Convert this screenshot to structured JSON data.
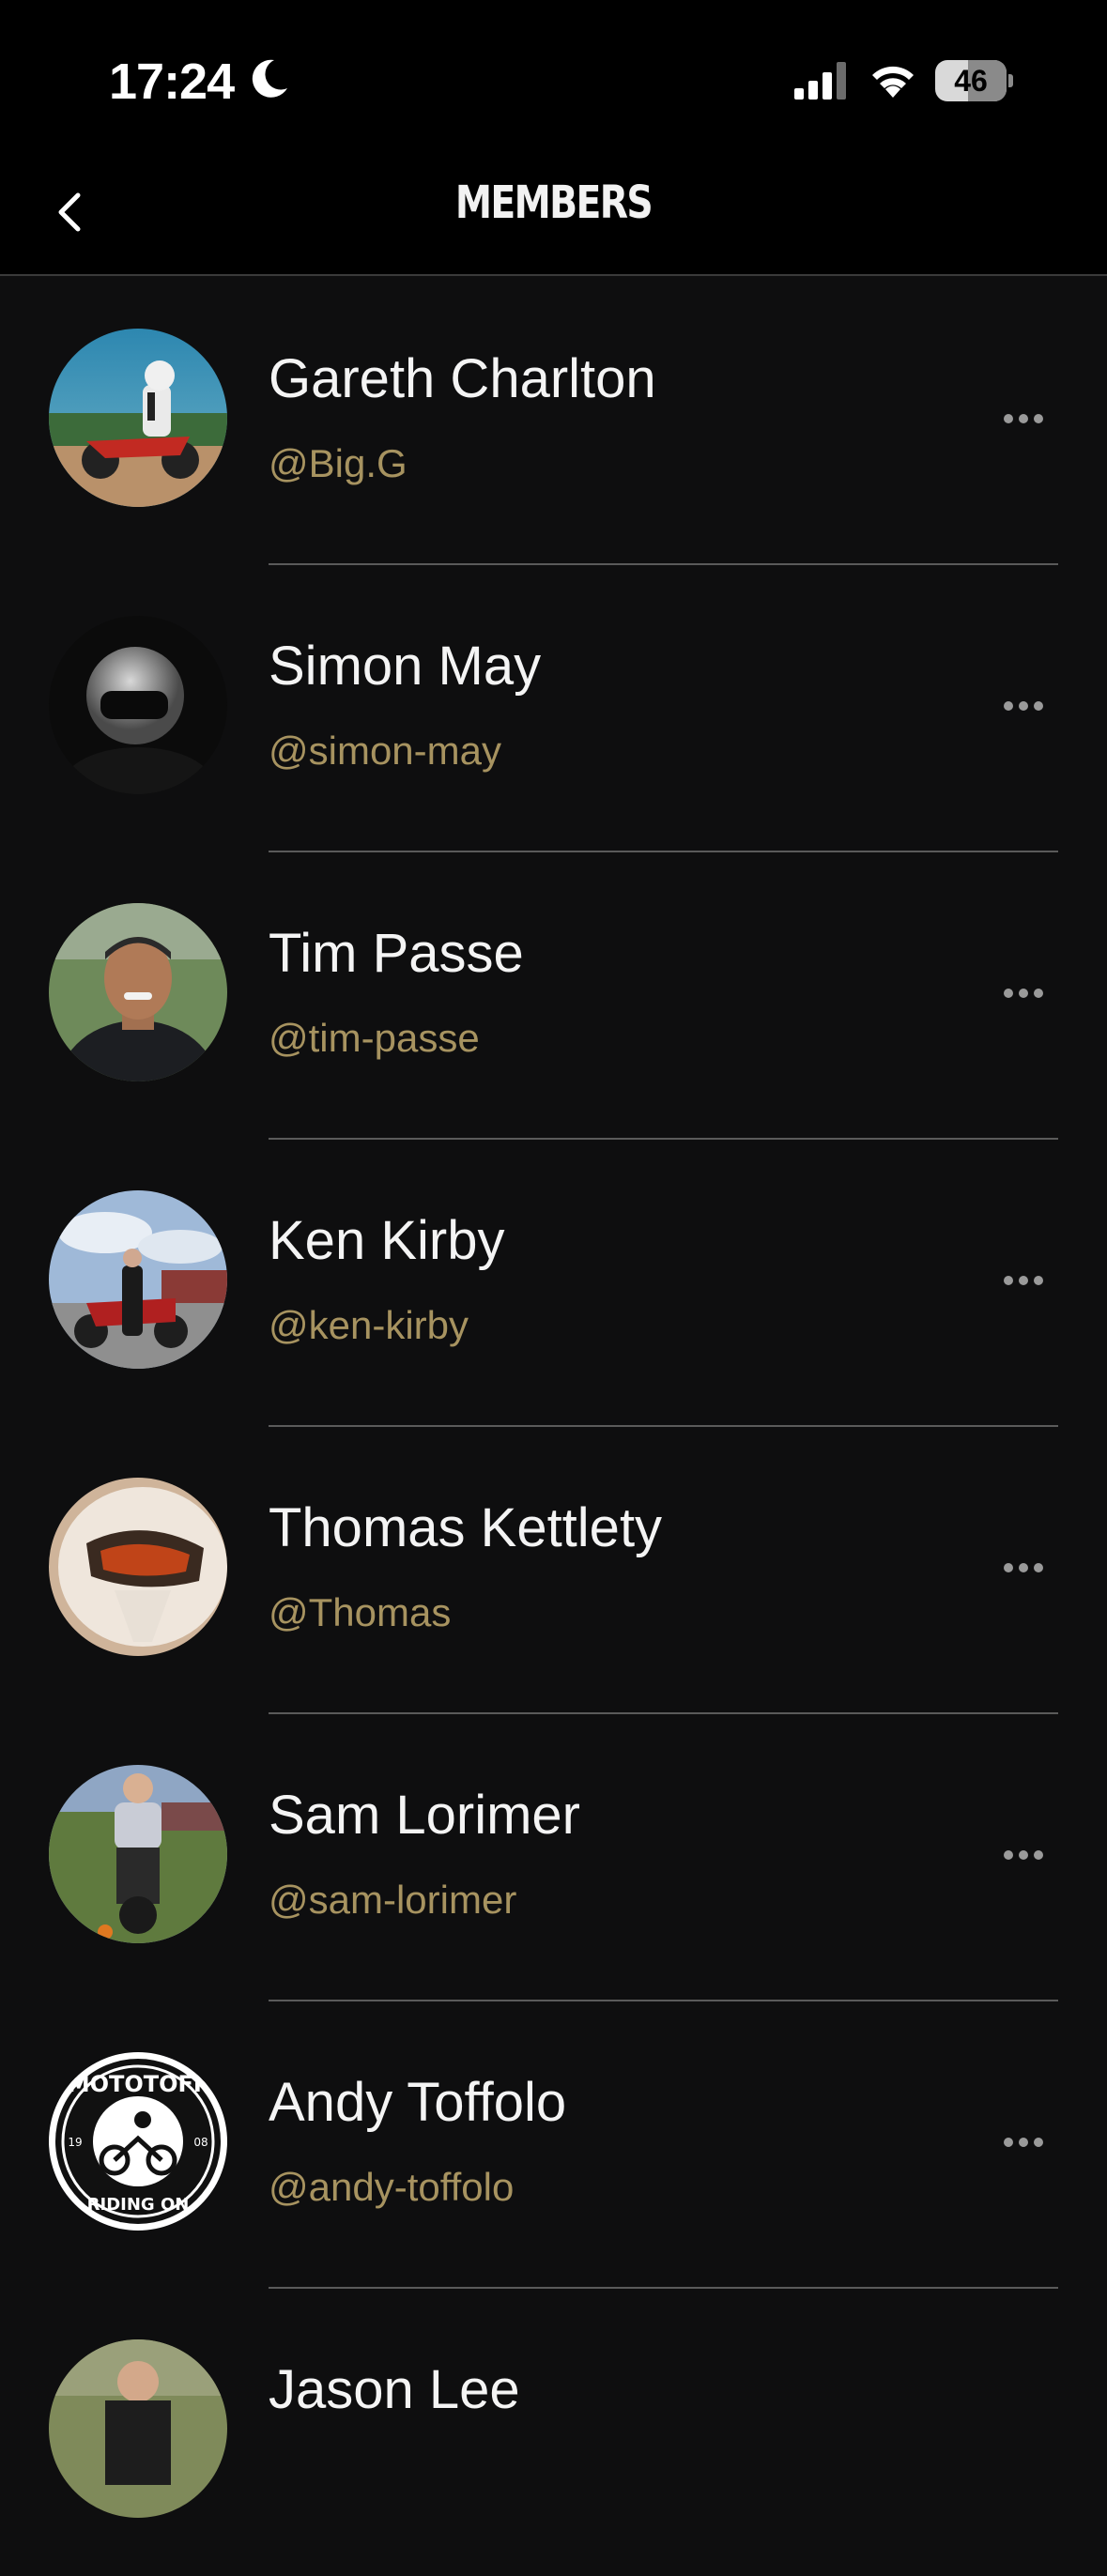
{
  "status_bar": {
    "time": "17:24",
    "battery_level": "46",
    "battery_fraction": 0.46
  },
  "header": {
    "title": "MEMBERS"
  },
  "members": [
    {
      "name": "Gareth Charlton",
      "handle": "@Big.G"
    },
    {
      "name": "Simon May",
      "handle": "@simon-may"
    },
    {
      "name": "Tim Passe",
      "handle": "@tim-passe"
    },
    {
      "name": "Ken Kirby",
      "handle": "@ken-kirby"
    },
    {
      "name": "Thomas Kettlety",
      "handle": "@Thomas"
    },
    {
      "name": "Sam Lorimer",
      "handle": "@sam-lorimer"
    },
    {
      "name": "Andy Toffolo",
      "handle": "@andy-toffolo"
    },
    {
      "name": "Jason Lee",
      "handle": ""
    }
  ],
  "logo_text": {
    "top": "MOTOTOFF",
    "bottom": "RIDING ON",
    "left": "19",
    "right": "08"
  },
  "colors": {
    "background": "#0e0e0f",
    "handle": "#a79360",
    "divider": "#5a5a5a"
  },
  "icons": {
    "back": "chevron-left-icon",
    "more": "ellipsis-icon",
    "moon": "moon-icon",
    "signal": "cellular-signal-icon",
    "wifi": "wifi-icon",
    "battery": "battery-icon"
  }
}
